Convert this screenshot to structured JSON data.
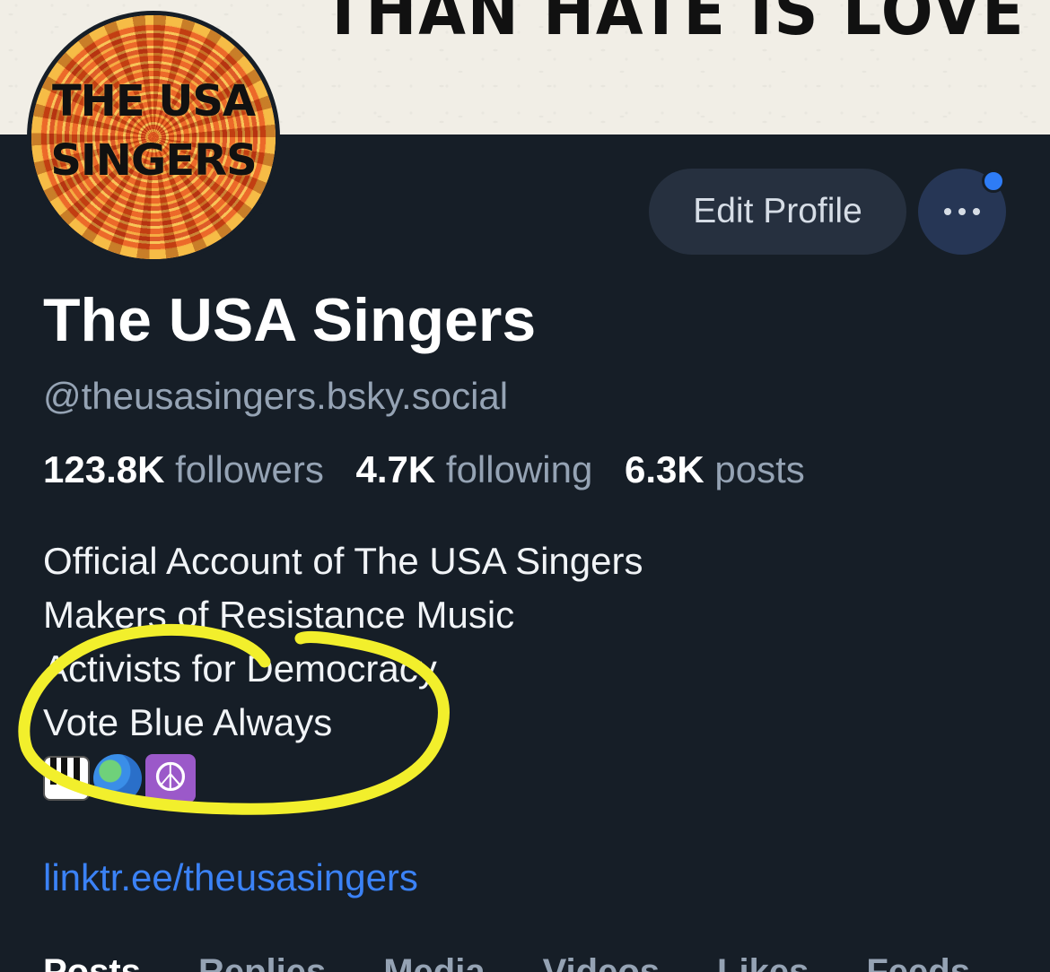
{
  "banner": {
    "text": "THAN HATE IS LOVE"
  },
  "avatar": {
    "line1": "THE USA",
    "line2": "SINGERS"
  },
  "actions": {
    "edit_label": "Edit Profile",
    "more_icon": "ellipsis-icon",
    "notification_color": "#2e7cf6"
  },
  "profile": {
    "display_name": "The USA Singers",
    "handle": "@theusasingers.bsky.social"
  },
  "stats": {
    "followers_count": "123.8K",
    "followers_label": "followers",
    "following_count": "4.7K",
    "following_label": "following",
    "posts_count": "6.3K",
    "posts_label": "posts"
  },
  "bio": {
    "lines": [
      "Official Account of The USA Singers",
      "Makers of Resistance Music",
      "Activists for Democracy",
      "Vote Blue Always"
    ],
    "emojis": [
      "piano-icon",
      "globe-icon",
      "peace-symbol-icon"
    ]
  },
  "link": "linktr.ee/theusasingers",
  "tabs": [
    "Posts",
    "Replies",
    "Media",
    "Videos",
    "Likes",
    "Feeds"
  ],
  "colors": {
    "background": "#161e27",
    "accent": "#3b82f6",
    "highlight_annotation": "#f2ef2c"
  }
}
